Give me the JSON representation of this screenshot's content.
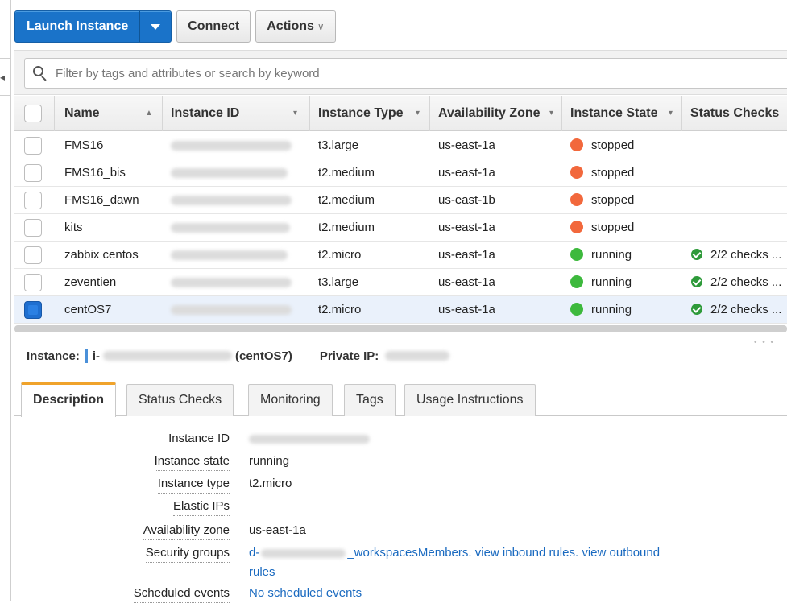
{
  "toolbar": {
    "launch_label": "Launch Instance",
    "connect_label": "Connect",
    "actions_label": "Actions"
  },
  "filter": {
    "placeholder": "Filter by tags and attributes or search by keyword"
  },
  "table": {
    "headers": {
      "name": "Name",
      "instance_id": "Instance ID",
      "instance_type": "Instance Type",
      "availability_zone": "Availability Zone",
      "instance_state": "Instance State",
      "status_checks": "Status Checks"
    },
    "rows": [
      {
        "name": "FMS16",
        "type": "t3.large",
        "zone": "us-east-1a",
        "state": "stopped",
        "checks": ""
      },
      {
        "name": "FMS16_bis",
        "type": "t2.medium",
        "zone": "us-east-1a",
        "state": "stopped",
        "checks": ""
      },
      {
        "name": "FMS16_dawn",
        "type": "t2.medium",
        "zone": "us-east-1b",
        "state": "stopped",
        "checks": ""
      },
      {
        "name": "kits",
        "type": "t2.medium",
        "zone": "us-east-1a",
        "state": "stopped",
        "checks": ""
      },
      {
        "name": "zabbix centos",
        "type": "t2.micro",
        "zone": "us-east-1a",
        "state": "running",
        "checks": "2/2 checks ..."
      },
      {
        "name": "zeventien",
        "type": "t3.large",
        "zone": "us-east-1a",
        "state": "running",
        "checks": "2/2 checks ..."
      },
      {
        "name": "centOS7",
        "type": "t2.micro",
        "zone": "us-east-1a",
        "state": "running",
        "checks": "2/2 checks ..."
      }
    ]
  },
  "colors": {
    "stopped": "#f2683c",
    "running": "#3db93d",
    "primary": "#1a73c9",
    "tab_accent": "#f0a32b",
    "link": "#1a6ac0"
  },
  "instance_summary": {
    "instance_label": "Instance:",
    "id_prefix": "i-",
    "name": "(centOS7)",
    "private_ip_label": "Private IP:"
  },
  "tabs": [
    "Description",
    "Status Checks",
    "Monitoring",
    "Tags",
    "Usage Instructions"
  ],
  "details": {
    "instance_id_label": "Instance ID",
    "instance_state_label": "Instance state",
    "instance_state_value": "running",
    "instance_type_label": "Instance type",
    "instance_type_value": "t2.micro",
    "elastic_ips_label": "Elastic IPs",
    "availability_zone_label": "Availability zone",
    "availability_zone_value": "us-east-1a",
    "security_groups_label": "Security groups",
    "security_groups_prefix": "d-",
    "security_groups_suffix": "_workspacesMembers.",
    "view_inbound": "view inbound rules.",
    "view_outbound": "view outbound",
    "rules_wrap": "rules",
    "scheduled_events_label": "Scheduled events",
    "scheduled_events_value": "No scheduled events"
  }
}
